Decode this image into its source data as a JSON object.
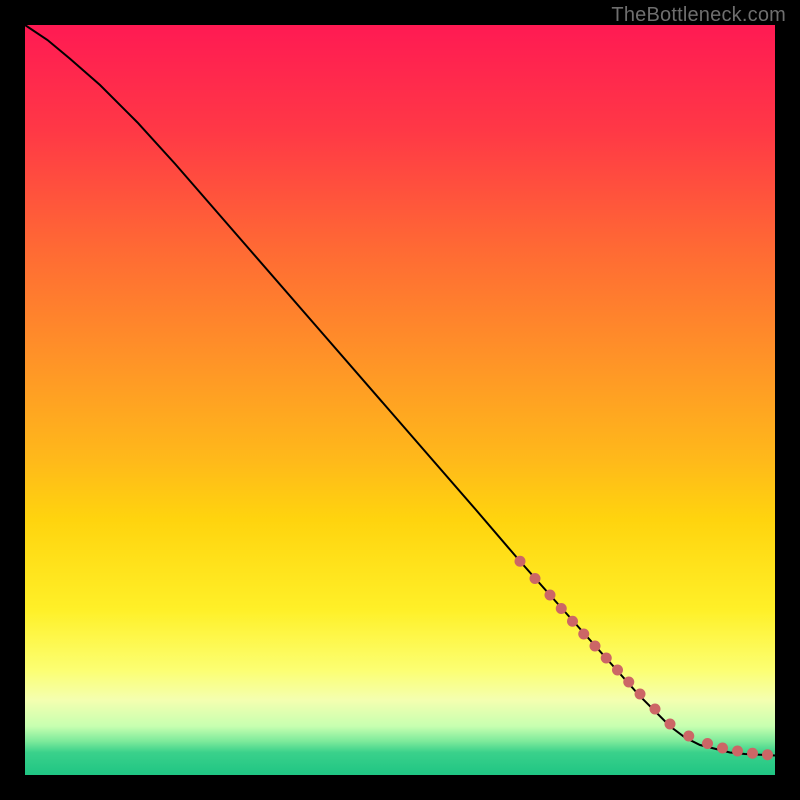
{
  "watermark": "TheBottleneck.com",
  "chart_data": {
    "type": "line",
    "title": "",
    "xlabel": "",
    "ylabel": "",
    "xlim": [
      0,
      100
    ],
    "ylim": [
      0,
      100
    ],
    "grid": false,
    "legend": false,
    "background_gradient_stops": [
      {
        "offset": 0.0,
        "color": "#ff1a53"
      },
      {
        "offset": 0.14,
        "color": "#ff3846"
      },
      {
        "offset": 0.3,
        "color": "#ff6a34"
      },
      {
        "offset": 0.46,
        "color": "#ff9726"
      },
      {
        "offset": 0.58,
        "color": "#ffb91a"
      },
      {
        "offset": 0.66,
        "color": "#ffd40e"
      },
      {
        "offset": 0.78,
        "color": "#fff028"
      },
      {
        "offset": 0.86,
        "color": "#fcff72"
      },
      {
        "offset": 0.9,
        "color": "#f4ffb0"
      },
      {
        "offset": 0.935,
        "color": "#c7ffb0"
      },
      {
        "offset": 0.955,
        "color": "#7dea9b"
      },
      {
        "offset": 0.97,
        "color": "#3ad18b"
      },
      {
        "offset": 1.0,
        "color": "#1fc583"
      }
    ],
    "series": [
      {
        "name": "curve",
        "stroke": "#000000",
        "x": [
          0,
          3,
          6,
          10,
          15,
          20,
          30,
          40,
          50,
          60,
          66,
          70,
          74,
          78,
          82,
          86,
          88,
          90,
          92,
          94,
          96,
          98,
          100
        ],
        "y": [
          100,
          98,
          95.5,
          92,
          87,
          81.5,
          70,
          58.5,
          47,
          35.5,
          28.5,
          24,
          19.5,
          15,
          10.5,
          6.5,
          5,
          4,
          3.5,
          3,
          2.8,
          2.7,
          2.6
        ]
      }
    ],
    "dotted_segment": {
      "name": "highlighted-range",
      "color": "#cc6666",
      "dot_radius_px": 5.5,
      "x": [
        66,
        68,
        70,
        71.5,
        73,
        74.5,
        76,
        77.5,
        79,
        80.5,
        82,
        84,
        86,
        88.5,
        91,
        93,
        95,
        97,
        99
      ],
      "y": [
        28.5,
        26.2,
        24,
        22.2,
        20.5,
        18.8,
        17.2,
        15.6,
        14,
        12.4,
        10.8,
        8.8,
        6.8,
        5.2,
        4.2,
        3.6,
        3.2,
        2.9,
        2.7
      ]
    }
  }
}
